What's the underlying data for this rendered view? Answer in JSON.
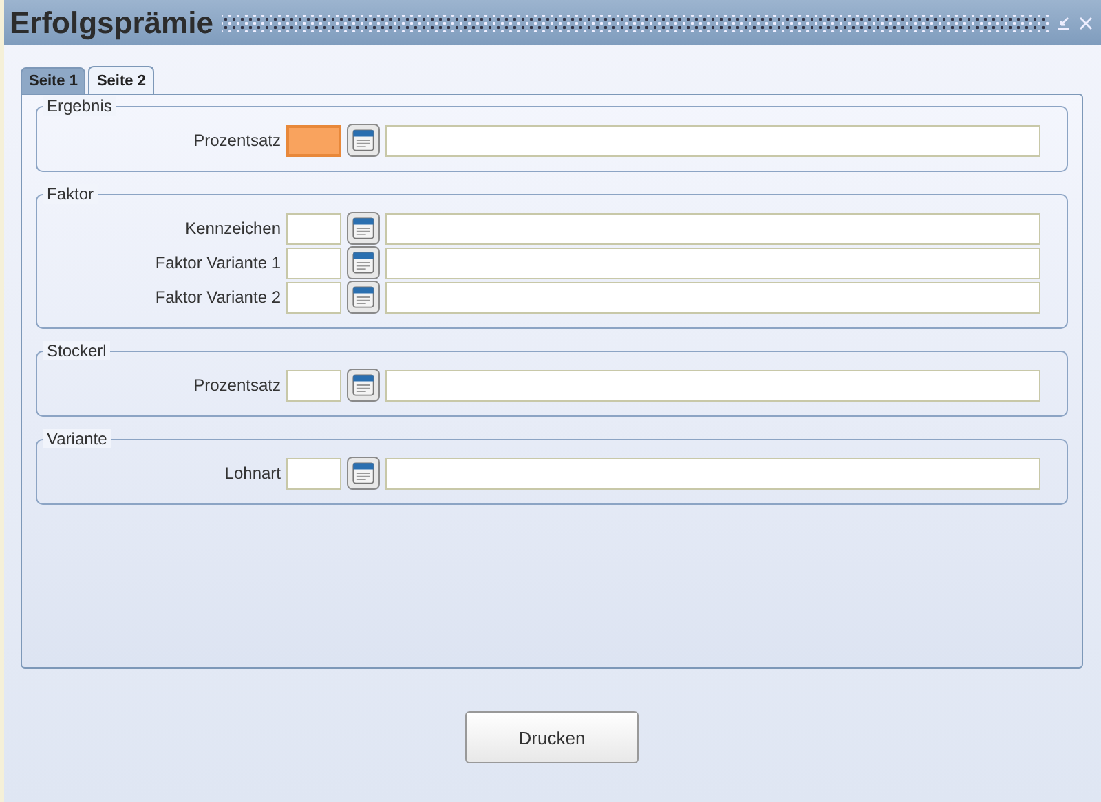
{
  "window": {
    "title": "Erfolgsprämie"
  },
  "tabs": [
    {
      "label": "Seite 1",
      "selected": false
    },
    {
      "label": "Seite 2",
      "selected": true
    }
  ],
  "groups": [
    {
      "title": "Ergebnis",
      "rows": [
        {
          "label": "Prozentsatz",
          "focused": true
        }
      ]
    },
    {
      "title": "Faktor",
      "rows": [
        {
          "label": "Kennzeichen",
          "focused": false
        },
        {
          "label": "Faktor Variante 1",
          "focused": false
        },
        {
          "label": "Faktor Variante 2",
          "focused": false
        }
      ]
    },
    {
      "title": "Stockerl",
      "rows": [
        {
          "label": "Prozentsatz",
          "focused": false
        }
      ]
    },
    {
      "title": "Variante",
      "rows": [
        {
          "label": "Lohnart",
          "focused": false
        }
      ]
    }
  ],
  "buttons": [
    "Drucken"
  ]
}
